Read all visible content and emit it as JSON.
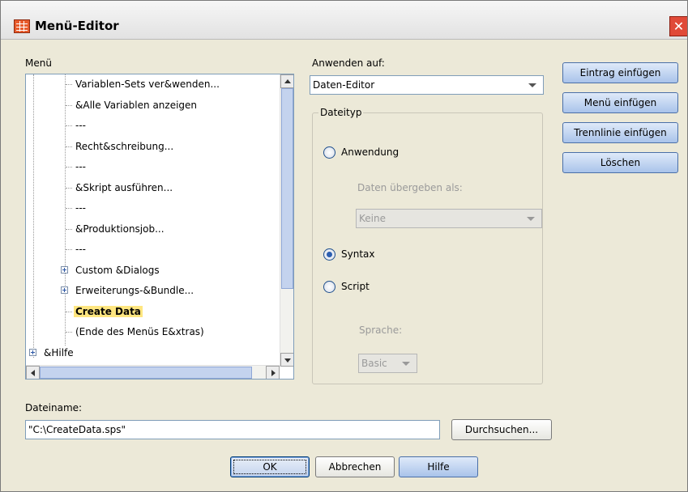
{
  "window": {
    "title": "Menü-Editor",
    "close_glyph": "✕",
    "colors": {
      "titlebar": "#ececec",
      "close_button": "#e04a38",
      "dialog_bg": "#ece9d8",
      "selection": "#ffe680",
      "button_blue": "#a9c3ea"
    }
  },
  "menu_panel": {
    "label": "Menü",
    "tree": [
      {
        "label": "Variablen-Sets ver&wenden...",
        "expandable": false,
        "selected": false
      },
      {
        "label": "&Alle Variablen anzeigen",
        "expandable": false,
        "selected": false
      },
      {
        "label": "---",
        "expandable": false,
        "selected": false
      },
      {
        "label": "Recht&schreibung...",
        "expandable": false,
        "selected": false
      },
      {
        "label": "---",
        "expandable": false,
        "selected": false
      },
      {
        "label": "&Skript ausführen...",
        "expandable": false,
        "selected": false
      },
      {
        "label": "---",
        "expandable": false,
        "selected": false
      },
      {
        "label": "&Produktionsjob...",
        "expandable": false,
        "selected": false
      },
      {
        "label": "---",
        "expandable": false,
        "selected": false
      },
      {
        "label": "Custom &Dialogs",
        "expandable": true,
        "selected": false
      },
      {
        "label": "Erweiterungs-&Bundle...",
        "expandable": true,
        "selected": false
      },
      {
        "label": "Create Data",
        "expandable": false,
        "selected": true
      },
      {
        "label": "(Ende des Menüs E&xtras)",
        "expandable": false,
        "selected": false
      },
      {
        "label": "&Hilfe",
        "expandable": true,
        "selected": false
      }
    ]
  },
  "apply_to": {
    "label": "Anwenden auf:",
    "value": "Daten-Editor"
  },
  "file_type": {
    "legend": "Dateityp",
    "options": {
      "application": "Anwendung",
      "syntax": "Syntax",
      "script": "Script"
    },
    "selected": "syntax",
    "pass_data_label": "Daten übergeben als:",
    "pass_data_value": "Keine",
    "language_label": "Sprache:",
    "language_value": "Basic"
  },
  "side_buttons": {
    "insert_item": "Eintrag einfügen",
    "insert_menu": "Menü einfügen",
    "insert_separator": "Trennlinie einfügen",
    "delete": "Löschen"
  },
  "filename": {
    "label": "Dateiname:",
    "value": "\"C:\\CreateData.sps\"",
    "browse": "Durchsuchen..."
  },
  "bottom_buttons": {
    "ok": "OK",
    "cancel": "Abbrechen",
    "help": "Hilfe"
  },
  "icons": {
    "app": "menu-editor-app-icon",
    "close": "close-icon",
    "expand": "plus-expander-icon",
    "dropdown": "chevron-down-icon",
    "scroll_up": "arrow-up-icon",
    "scroll_down": "arrow-down-icon",
    "scroll_left": "arrow-left-icon",
    "scroll_right": "arrow-right-icon"
  }
}
